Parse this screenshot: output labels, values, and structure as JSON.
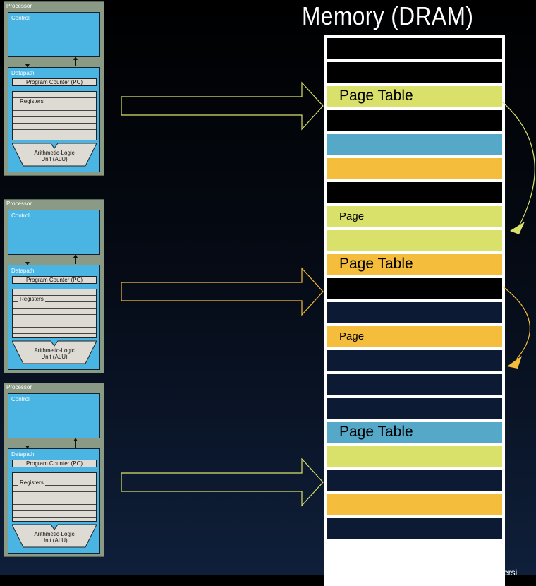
{
  "title": "Memory (DRAM)",
  "processor": {
    "label": "Processor",
    "control": "Control",
    "datapath": "Datapath",
    "pc": "Program Counter (PC)",
    "registers": "Registers",
    "alu_line1": "Arithmetic-Logic",
    "alu_line2": "Unit (ALU)"
  },
  "colors": {
    "green": "#d9e16a",
    "blue": "#56a8c8",
    "orange": "#f5bd3c",
    "black": "#000000",
    "navy": "#0c1a33",
    "control_blue": "#4ab4e2",
    "processor_gray": "#8a9a84"
  },
  "memory_rows": [
    {
      "color": "black",
      "label": ""
    },
    {
      "color": "black",
      "label": ""
    },
    {
      "color": "green",
      "label": "Page Table",
      "size": "big"
    },
    {
      "color": "black",
      "label": ""
    },
    {
      "color": "blue",
      "label": ""
    },
    {
      "color": "orange",
      "label": ""
    },
    {
      "color": "black",
      "label": ""
    },
    {
      "color": "green",
      "label": "Page",
      "size": "small"
    },
    {
      "color": "green",
      "label": ""
    },
    {
      "color": "orange",
      "label": "Page Table",
      "size": "big"
    },
    {
      "color": "black",
      "label": ""
    },
    {
      "color": "navy",
      "label": ""
    },
    {
      "color": "orange",
      "label": "Page",
      "size": "small"
    },
    {
      "color": "navy",
      "label": ""
    },
    {
      "color": "navy",
      "label": ""
    },
    {
      "color": "navy",
      "label": ""
    },
    {
      "color": "blue",
      "label": "Page Table",
      "size": "big"
    },
    {
      "color": "green",
      "label": ""
    },
    {
      "color": "navy",
      "label": ""
    },
    {
      "color": "orange",
      "label": ""
    },
    {
      "color": "navy",
      "label": ""
    }
  ],
  "corner_text": "Persi"
}
